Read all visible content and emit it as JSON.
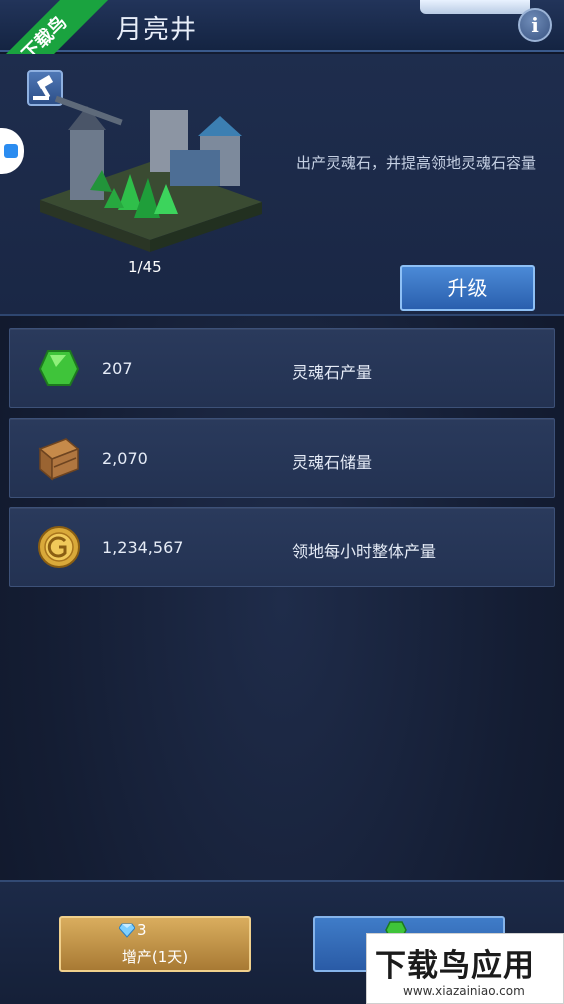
{
  "header": {
    "title": "月亮井",
    "info_label": "i"
  },
  "watermark": {
    "ribbon_text": "下载鸟",
    "brand_main": "下载鸟应用",
    "brand_url": "www.xiazainiao.com"
  },
  "building": {
    "level": "1/45",
    "description": "出产灵魂石，并提高领地灵魂石容量",
    "upgrade_label": "升级"
  },
  "stats": [
    {
      "icon": "green-gem-icon",
      "value": "207",
      "label": "灵魂石产量"
    },
    {
      "icon": "wooden-crate-icon",
      "value": "2,070",
      "label": "灵魂石储量"
    },
    {
      "icon": "gold-coin-icon",
      "value": "1,234,567",
      "label": "领地每小时整体产量"
    }
  ],
  "bottom": {
    "boost": {
      "cost": "3",
      "label": "增产(1天)"
    }
  },
  "colors": {
    "background": "#17213a",
    "row": "#2a3a5c",
    "upgrade": "#3a72c0",
    "boost": "#c9984a",
    "ribbon": "#1aa33f"
  }
}
